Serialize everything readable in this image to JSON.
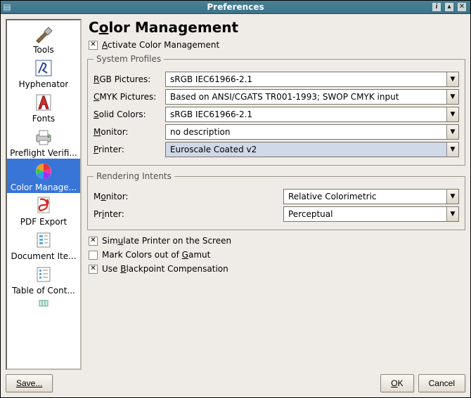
{
  "title": "Preferences",
  "sidebar": {
    "items": [
      {
        "label": "Tools"
      },
      {
        "label": "Hyphenator"
      },
      {
        "label": "Fonts"
      },
      {
        "label": "Preflight Verifi..."
      },
      {
        "label": "Color Manage..."
      },
      {
        "label": "PDF Export"
      },
      {
        "label": "Document Ite..."
      },
      {
        "label": "Table of Cont..."
      }
    ],
    "selected_index": 4
  },
  "panel": {
    "heading_pre": "C",
    "heading_un": "o",
    "heading_post": "lor Management",
    "activate": {
      "pre": "",
      "un": "A",
      "post": "ctivate Color Management",
      "checked": true
    },
    "system_profiles": {
      "legend": "System Profiles",
      "rgb": {
        "label_un": "R",
        "label_post": "GB Pictures:",
        "value": "sRGB IEC61966-2.1"
      },
      "cmyk": {
        "label_un": "C",
        "label_post": "MYK Pictures:",
        "value": "Based on ANSI/CGATS TR001-1993; SWOP CMYK input"
      },
      "solid": {
        "label_un": "S",
        "label_post": "olid Colors:",
        "value": "sRGB IEC61966-2.1"
      },
      "monitor": {
        "label_un": "M",
        "label_post": "onitor:",
        "value": "no description"
      },
      "printer": {
        "label_un": "P",
        "label_post": "rinter:",
        "value": "Euroscale Coated v2"
      }
    },
    "rendering_intents": {
      "legend": "Rendering Intents",
      "monitor": {
        "label_pre": "M",
        "label_un": "o",
        "label_post": "nitor:",
        "value": "Relative Colorimetric"
      },
      "printer": {
        "label_pre": "Pr",
        "label_un": "i",
        "label_post": "nter:",
        "value": "Perceptual"
      }
    },
    "simulate": {
      "pre": "Sim",
      "un": "u",
      "post": "late Printer on the Screen",
      "checked": true
    },
    "mark": {
      "pre": "Mark Colors out of ",
      "un": "G",
      "post": "amut",
      "checked": false
    },
    "blackpoint": {
      "pre": "Use ",
      "un": "B",
      "post": "lackpoint Compensation",
      "checked": true
    }
  },
  "buttons": {
    "save": "Save...",
    "ok_un": "O",
    "ok_post": "K",
    "cancel": "Cancel"
  }
}
